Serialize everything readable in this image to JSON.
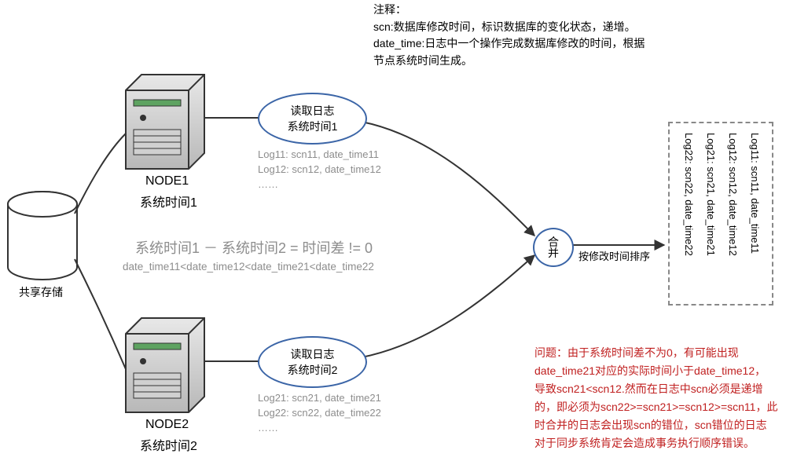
{
  "annotation": {
    "heading": "注释：",
    "line_scn": "scn:数据库修改时间，标识数据库的变化状态，递增。",
    "line_dt1": "date_time:日志中一个操作完成数据库修改的时间，根据",
    "line_dt2": "节点系统时间生成。"
  },
  "storage": {
    "label": "共享存储"
  },
  "node1": {
    "name": "NODE1",
    "subtitle": "系统时间1",
    "reader_l1": "读取日志",
    "reader_l2": "系统时间1",
    "log_lines": "Log11: scn11, date_time11\nLog12: scn12, date_time12\n……",
    "chart_values": [
      "Log11: scn11, date_time11",
      "Log12: scn12, date_time12"
    ]
  },
  "node2": {
    "name": "NODE2",
    "subtitle": "系统时间2",
    "reader_l1": "读取日志",
    "reader_l2": "系统时间2",
    "log_lines": "Log21: scn21, date_time21\nLog22: scn22, date_time22\n……",
    "chart_values": [
      "Log21: scn21, date_time21",
      "Log22: scn22, date_time22"
    ]
  },
  "center": {
    "diff_eq": "系统时间1 － 系统时间2 = 时间差 != 0",
    "order": "date_time11<date_time12<date_time21<date_time22"
  },
  "merge": {
    "label_l1": "合",
    "label_l2": "并",
    "arrow_label": "按修改时间排序"
  },
  "result": {
    "rows": [
      "Log11: scn11, date_time11",
      "Log12: scn12, date_time12",
      "Log21: scn21, date_time21",
      "Log22: scn22, date_time22"
    ]
  },
  "problem": {
    "l1": "问题：由于系统时间差不为0，有可能出现",
    "l2": "date_time21对应的实际时间小于date_time12，",
    "l3": "导致scn21<scn12.然而在日志中scn必须是递增",
    "l4": "的，即必须为scn22>=scn21>=scn12>=scn11，此",
    "l5": "时合并的日志会出现scn的错位，scn错位的日志",
    "l6": "对于同步系统肯定会造成事务执行顺序错误。"
  },
  "chart_data": {
    "type": "table",
    "title": "RAC 日志合并示意",
    "nodes": [
      {
        "name": "NODE1",
        "system_time": "系统时间1",
        "logs": [
          {
            "id": "Log11",
            "scn": "scn11",
            "date_time": "date_time11"
          },
          {
            "id": "Log12",
            "scn": "scn12",
            "date_time": "date_time12"
          }
        ]
      },
      {
        "name": "NODE2",
        "system_time": "系统时间2",
        "logs": [
          {
            "id": "Log21",
            "scn": "scn21",
            "date_time": "date_time21"
          },
          {
            "id": "Log22",
            "scn": "scn22",
            "date_time": "date_time22"
          }
        ]
      }
    ],
    "relation": "系统时间1 - 系统时间2 = 时间差 != 0",
    "date_time_order": [
      "date_time11",
      "date_time12",
      "date_time21",
      "date_time22"
    ],
    "merged_sorted_by_modify_time": [
      {
        "id": "Log11",
        "scn": "scn11",
        "date_time": "date_time11"
      },
      {
        "id": "Log12",
        "scn": "scn12",
        "date_time": "date_time12"
      },
      {
        "id": "Log21",
        "scn": "scn21",
        "date_time": "date_time21"
      },
      {
        "id": "Log22",
        "scn": "scn22",
        "date_time": "date_time22"
      }
    ],
    "scn_required_order": [
      "scn11",
      "scn12",
      "scn21",
      "scn22"
    ]
  }
}
